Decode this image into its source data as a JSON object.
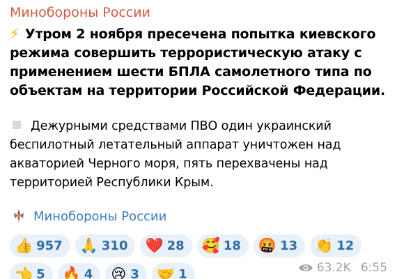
{
  "channel": {
    "name": "Минобороны России"
  },
  "headline": {
    "icon": "lightning-bolt-icon",
    "bolt": "⚡",
    "text": "Утром 2 ноября пресечена попытка киевского режима совершить террористическую атаку с применением шести БПЛА самолетного типа по объектам на территории Российской Федерации."
  },
  "body": {
    "icon": "gray-square-icon",
    "text": "Дежурными средствами ПВО один украинский беспилотный летательный аппарат уничтожен над акваторией Черного моря,  пять перехвачены над территорией Республики Крым."
  },
  "signature": {
    "icon": "ministry-emblem-icon",
    "label": "Минобороны России"
  },
  "reactions": [
    {
      "icon": "thumbs-up-icon",
      "emoji": "👍",
      "count": "957"
    },
    {
      "icon": "praying-hands-icon",
      "emoji": "🙏",
      "count": "310"
    },
    {
      "icon": "red-heart-icon",
      "emoji": "❤️",
      "count": "28"
    },
    {
      "icon": "smiling-face-with-hearts-icon",
      "emoji": "🥰",
      "count": "18"
    },
    {
      "icon": "angry-face-with-symbols-icon",
      "emoji": "🤬",
      "count": "13"
    },
    {
      "icon": "clapping-hands-icon",
      "emoji": "👏",
      "count": "12"
    },
    {
      "icon": "pointing-hand-icon",
      "emoji": "👈",
      "count": "5"
    },
    {
      "icon": "fire-icon",
      "emoji": "🔥",
      "count": "4"
    },
    {
      "icon": "crying-face-icon",
      "emoji": "😢",
      "count": "3"
    },
    {
      "icon": "handshake-icon",
      "emoji": "🤝",
      "count": "1"
    }
  ],
  "meta": {
    "views": "63.2K",
    "time": "6:55",
    "views_icon": "eye-icon"
  },
  "colors": {
    "channel": "#d25a3c",
    "signature": "#3a7ec1",
    "reaction_bg": "#e8f1fa",
    "reaction_count": "#2f6ea5",
    "meta": "#a3a3a3"
  }
}
